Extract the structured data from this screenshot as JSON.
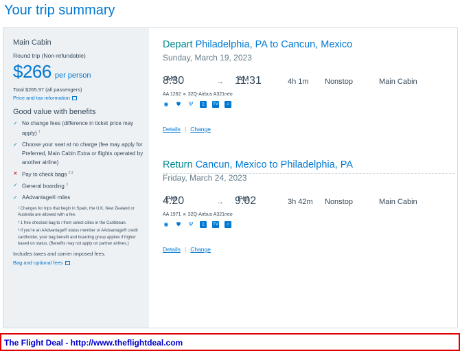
{
  "page": {
    "title": "Your trip summary"
  },
  "sidebar": {
    "cabin": "Main Cabin",
    "trip_type": "Round trip (Non-refundable)",
    "price": "$266",
    "per_person": "per person",
    "total": "Total $265.97 (all passengers)",
    "price_tax_link": "Price and tax information",
    "benefits_title": "Good value with benefits",
    "benefits": [
      {
        "icon": "check-icon",
        "text": "No change fees (difference in ticket price may apply)",
        "sup": "1"
      },
      {
        "icon": "check-icon",
        "text": "Choose your seat at no charge (fee may apply for Preferred, Main Cabin Extra or flights operated by another airline)",
        "sup": ""
      },
      {
        "icon": "cross-icon",
        "text": "Pay to check bags",
        "sup": "2 3"
      },
      {
        "icon": "check-icon",
        "text": "General boarding",
        "sup": "3"
      },
      {
        "icon": "check-icon",
        "text": "AAdvantage® miles",
        "sup": ""
      }
    ],
    "footnotes": [
      "¹ Changes for trips that begin in Spain, the U.K, New Zealand or Australia are allowed with a fee.",
      "² 1 free checked bag to / from select cities in the Caribbean.",
      "³ If you're an AAdvantage® status member or AAdvantage® credit cardholder, your bag benefit and boarding group applies if higher based on status. (Benefits may not apply on partner airlines.)"
    ],
    "includes": "Includes taxes and carrier imposed fees.",
    "bag_link": "Bag and optional fees"
  },
  "segments": [
    {
      "kind": "Depart",
      "route": "Philadelphia, PA to Cancun, Mexico",
      "date": "Sunday, March 19, 2023",
      "dep_time": "8:30",
      "dep_ampm": "AM",
      "arr_time": "11:31",
      "arr_ampm": "AM",
      "duration": "4h 1m",
      "stops": "Nonstop",
      "cabin": "Main Cabin",
      "flight": "AA 1262",
      "aircraft": "32Q-Airbus A321neo",
      "details_link": "Details",
      "change_link": "Change"
    },
    {
      "kind": "Return",
      "route": "Cancun, Mexico to Philadelphia, PA",
      "date": "Friday, March 24, 2023",
      "dep_time": "4:20",
      "dep_ampm": "PM",
      "arr_time": "9:02",
      "arr_ampm": "PM",
      "duration": "3h 42m",
      "stops": "Nonstop",
      "cabin": "Main Cabin",
      "flight": "AA 1971",
      "aircraft": "32Q-Airbus A321neo",
      "details_link": "Details",
      "change_link": "Change"
    }
  ],
  "amenities": [
    "wifi-icon",
    "shield-icon",
    "usb-icon",
    "phone-icon",
    "tv-icon",
    "app-icon"
  ],
  "footer": {
    "banner_text": "The Flight Deal - http://www.theflightdeal.com"
  },
  "colors": {
    "accent": "#0078d2",
    "teal": "#00878f",
    "banner_border": "#e00000",
    "banner_text": "#0000cc"
  }
}
